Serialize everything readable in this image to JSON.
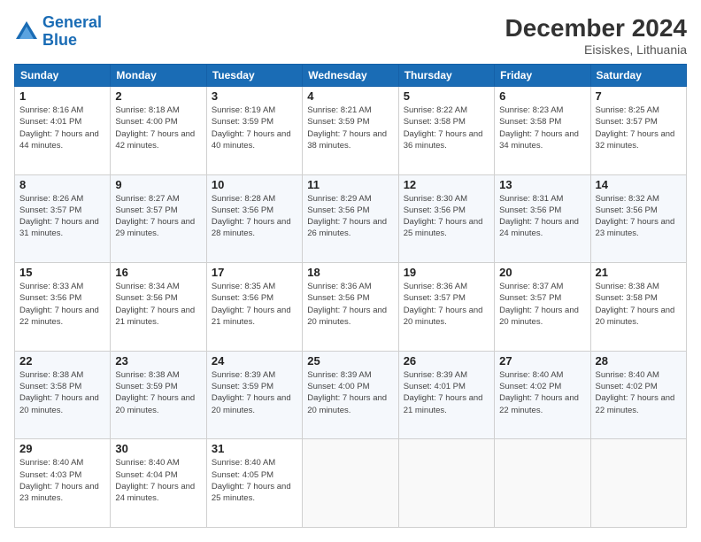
{
  "header": {
    "logo_line1": "General",
    "logo_line2": "Blue",
    "month_title": "December 2024",
    "location": "Eisiskes, Lithuania"
  },
  "weekdays": [
    "Sunday",
    "Monday",
    "Tuesday",
    "Wednesday",
    "Thursday",
    "Friday",
    "Saturday"
  ],
  "weeks": [
    [
      {
        "day": "1",
        "sunrise": "Sunrise: 8:16 AM",
        "sunset": "Sunset: 4:01 PM",
        "daylight": "Daylight: 7 hours and 44 minutes."
      },
      {
        "day": "2",
        "sunrise": "Sunrise: 8:18 AM",
        "sunset": "Sunset: 4:00 PM",
        "daylight": "Daylight: 7 hours and 42 minutes."
      },
      {
        "day": "3",
        "sunrise": "Sunrise: 8:19 AM",
        "sunset": "Sunset: 3:59 PM",
        "daylight": "Daylight: 7 hours and 40 minutes."
      },
      {
        "day": "4",
        "sunrise": "Sunrise: 8:21 AM",
        "sunset": "Sunset: 3:59 PM",
        "daylight": "Daylight: 7 hours and 38 minutes."
      },
      {
        "day": "5",
        "sunrise": "Sunrise: 8:22 AM",
        "sunset": "Sunset: 3:58 PM",
        "daylight": "Daylight: 7 hours and 36 minutes."
      },
      {
        "day": "6",
        "sunrise": "Sunrise: 8:23 AM",
        "sunset": "Sunset: 3:58 PM",
        "daylight": "Daylight: 7 hours and 34 minutes."
      },
      {
        "day": "7",
        "sunrise": "Sunrise: 8:25 AM",
        "sunset": "Sunset: 3:57 PM",
        "daylight": "Daylight: 7 hours and 32 minutes."
      }
    ],
    [
      {
        "day": "8",
        "sunrise": "Sunrise: 8:26 AM",
        "sunset": "Sunset: 3:57 PM",
        "daylight": "Daylight: 7 hours and 31 minutes."
      },
      {
        "day": "9",
        "sunrise": "Sunrise: 8:27 AM",
        "sunset": "Sunset: 3:57 PM",
        "daylight": "Daylight: 7 hours and 29 minutes."
      },
      {
        "day": "10",
        "sunrise": "Sunrise: 8:28 AM",
        "sunset": "Sunset: 3:56 PM",
        "daylight": "Daylight: 7 hours and 28 minutes."
      },
      {
        "day": "11",
        "sunrise": "Sunrise: 8:29 AM",
        "sunset": "Sunset: 3:56 PM",
        "daylight": "Daylight: 7 hours and 26 minutes."
      },
      {
        "day": "12",
        "sunrise": "Sunrise: 8:30 AM",
        "sunset": "Sunset: 3:56 PM",
        "daylight": "Daylight: 7 hours and 25 minutes."
      },
      {
        "day": "13",
        "sunrise": "Sunrise: 8:31 AM",
        "sunset": "Sunset: 3:56 PM",
        "daylight": "Daylight: 7 hours and 24 minutes."
      },
      {
        "day": "14",
        "sunrise": "Sunrise: 8:32 AM",
        "sunset": "Sunset: 3:56 PM",
        "daylight": "Daylight: 7 hours and 23 minutes."
      }
    ],
    [
      {
        "day": "15",
        "sunrise": "Sunrise: 8:33 AM",
        "sunset": "Sunset: 3:56 PM",
        "daylight": "Daylight: 7 hours and 22 minutes."
      },
      {
        "day": "16",
        "sunrise": "Sunrise: 8:34 AM",
        "sunset": "Sunset: 3:56 PM",
        "daylight": "Daylight: 7 hours and 21 minutes."
      },
      {
        "day": "17",
        "sunrise": "Sunrise: 8:35 AM",
        "sunset": "Sunset: 3:56 PM",
        "daylight": "Daylight: 7 hours and 21 minutes."
      },
      {
        "day": "18",
        "sunrise": "Sunrise: 8:36 AM",
        "sunset": "Sunset: 3:56 PM",
        "daylight": "Daylight: 7 hours and 20 minutes."
      },
      {
        "day": "19",
        "sunrise": "Sunrise: 8:36 AM",
        "sunset": "Sunset: 3:57 PM",
        "daylight": "Daylight: 7 hours and 20 minutes."
      },
      {
        "day": "20",
        "sunrise": "Sunrise: 8:37 AM",
        "sunset": "Sunset: 3:57 PM",
        "daylight": "Daylight: 7 hours and 20 minutes."
      },
      {
        "day": "21",
        "sunrise": "Sunrise: 8:38 AM",
        "sunset": "Sunset: 3:58 PM",
        "daylight": "Daylight: 7 hours and 20 minutes."
      }
    ],
    [
      {
        "day": "22",
        "sunrise": "Sunrise: 8:38 AM",
        "sunset": "Sunset: 3:58 PM",
        "daylight": "Daylight: 7 hours and 20 minutes."
      },
      {
        "day": "23",
        "sunrise": "Sunrise: 8:38 AM",
        "sunset": "Sunset: 3:59 PM",
        "daylight": "Daylight: 7 hours and 20 minutes."
      },
      {
        "day": "24",
        "sunrise": "Sunrise: 8:39 AM",
        "sunset": "Sunset: 3:59 PM",
        "daylight": "Daylight: 7 hours and 20 minutes."
      },
      {
        "day": "25",
        "sunrise": "Sunrise: 8:39 AM",
        "sunset": "Sunset: 4:00 PM",
        "daylight": "Daylight: 7 hours and 20 minutes."
      },
      {
        "day": "26",
        "sunrise": "Sunrise: 8:39 AM",
        "sunset": "Sunset: 4:01 PM",
        "daylight": "Daylight: 7 hours and 21 minutes."
      },
      {
        "day": "27",
        "sunrise": "Sunrise: 8:40 AM",
        "sunset": "Sunset: 4:02 PM",
        "daylight": "Daylight: 7 hours and 22 minutes."
      },
      {
        "day": "28",
        "sunrise": "Sunrise: 8:40 AM",
        "sunset": "Sunset: 4:02 PM",
        "daylight": "Daylight: 7 hours and 22 minutes."
      }
    ],
    [
      {
        "day": "29",
        "sunrise": "Sunrise: 8:40 AM",
        "sunset": "Sunset: 4:03 PM",
        "daylight": "Daylight: 7 hours and 23 minutes."
      },
      {
        "day": "30",
        "sunrise": "Sunrise: 8:40 AM",
        "sunset": "Sunset: 4:04 PM",
        "daylight": "Daylight: 7 hours and 24 minutes."
      },
      {
        "day": "31",
        "sunrise": "Sunrise: 8:40 AM",
        "sunset": "Sunset: 4:05 PM",
        "daylight": "Daylight: 7 hours and 25 minutes."
      },
      null,
      null,
      null,
      null
    ]
  ]
}
